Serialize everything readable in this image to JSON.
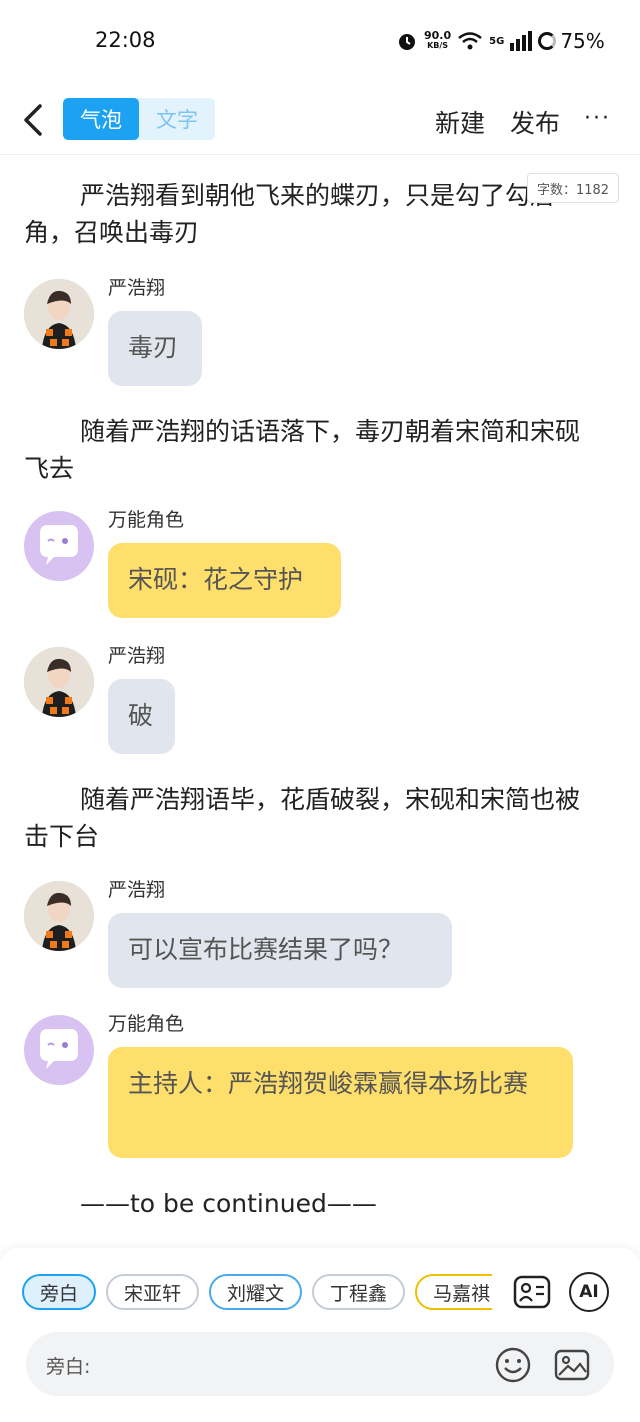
{
  "status_bar": {
    "time": "22:08",
    "net_speed_value": "90.0",
    "net_speed_unit": "KB/S",
    "signal": "5G",
    "battery": "75%"
  },
  "toolbar": {
    "mode_bubble": "气泡",
    "mode_text": "文字",
    "new_label": "新建",
    "publish_label": "发布",
    "more_label": "···"
  },
  "word_count": "字数：1182",
  "content": {
    "narration_1": "严浩翔看到朝他飞来的蝶刃，只是勾了勾唇角，召唤出毒刃",
    "msg_1": {
      "sender": "严浩翔",
      "text": "毒刃"
    },
    "narration_2": "随着严浩翔的话语落下，毒刃朝着宋简和宋砚飞去",
    "msg_2": {
      "sender": "万能角色",
      "text": "宋砚：花之守护"
    },
    "msg_3": {
      "sender": "严浩翔",
      "text": "破"
    },
    "narration_3": "随着严浩翔语毕，花盾破裂，宋砚和宋简也被击下台",
    "msg_4": {
      "sender": "严浩翔",
      "text": "可以宣布比赛结果了吗？"
    },
    "msg_5": {
      "sender": "万能角色",
      "text": "主持人：严浩翔贺峻霖赢得本场比赛"
    },
    "narration_4": "——to be continued——"
  },
  "bottom": {
    "chips": [
      "旁白",
      "宋亚轩",
      "刘耀文",
      "丁程鑫",
      "马嘉祺"
    ],
    "ai_label": "AI",
    "input_prefix": "旁白:"
  },
  "colors": {
    "accent": "#1da1f2",
    "bubble_grey": "#e1e6ee",
    "bubble_yellow": "#ffdf6b",
    "bot_avatar": "#d8c2f2"
  }
}
